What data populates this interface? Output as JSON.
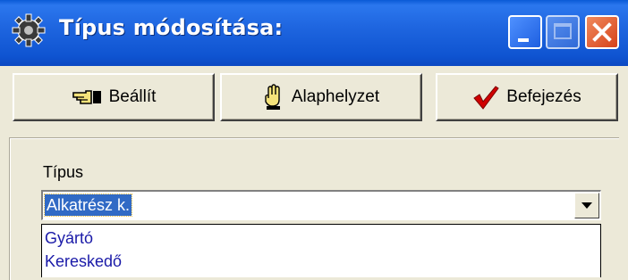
{
  "window": {
    "title": "Típus módosítása:",
    "icons": {
      "app": "gear-icon",
      "minimize": "minimize-icon",
      "maximize": "maximize-icon",
      "close": "close-icon"
    }
  },
  "toolbar": {
    "set_label": "Beállít",
    "set_icon": "pointing-hand-icon",
    "reset_label": "Alaphelyzet",
    "reset_icon": "raised-hand-icon",
    "finish_label": "Befejezés",
    "finish_icon": "checkmark-icon"
  },
  "form": {
    "type_label": "Típus",
    "type_value": "Alkatrész k.",
    "dropdown_icon": "chevron-down-icon",
    "options": [
      "Gyártó",
      "Kereskedő"
    ]
  },
  "colors": {
    "titlebar": "#0b55d6",
    "selection": "#316ac5",
    "face": "#ece9d8",
    "close_button": "#e05a2a",
    "checkmark": "#d00000",
    "option_text": "#1a1aa8"
  }
}
